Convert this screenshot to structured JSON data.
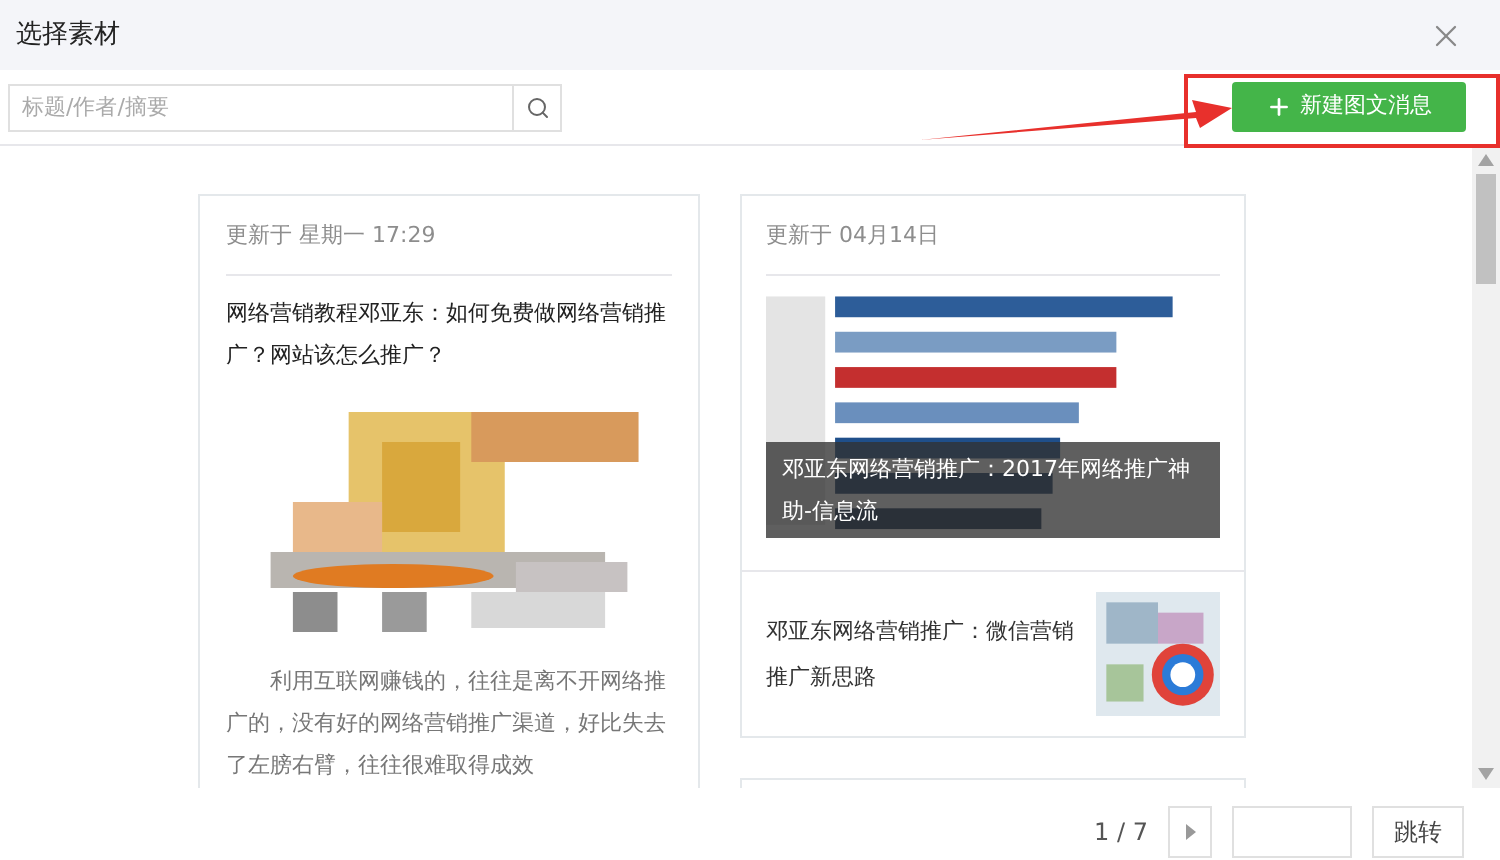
{
  "dialog": {
    "title": "选择素材"
  },
  "search": {
    "placeholder": "标题/作者/摘要"
  },
  "new_button": {
    "label": "新建图文消息"
  },
  "columns": [
    {
      "cards": [
        {
          "kind": "single",
          "updated": "更新于 星期一 17:29",
          "title": "网络营销教程邓亚东：如何免费做网络营销推广？网站该怎么推广？",
          "summary": "利用互联网赚钱的，往往是离不开网络推广的，没有好的网络营销推广渠道，好比失去了左膀右臂，往往很难取得成效"
        }
      ]
    },
    {
      "cards": [
        {
          "kind": "multi",
          "updated": "更新于 04月14日",
          "cover_title": "邓亚东网络营销推广：2017年网络推广神助-信息流",
          "items": [
            {
              "title": "邓亚东网络营销推广：微信营销推广新思路"
            }
          ]
        },
        {
          "kind": "stub"
        }
      ]
    }
  ],
  "pagination": {
    "page": "1 / 7",
    "jump_label": "跳转"
  }
}
